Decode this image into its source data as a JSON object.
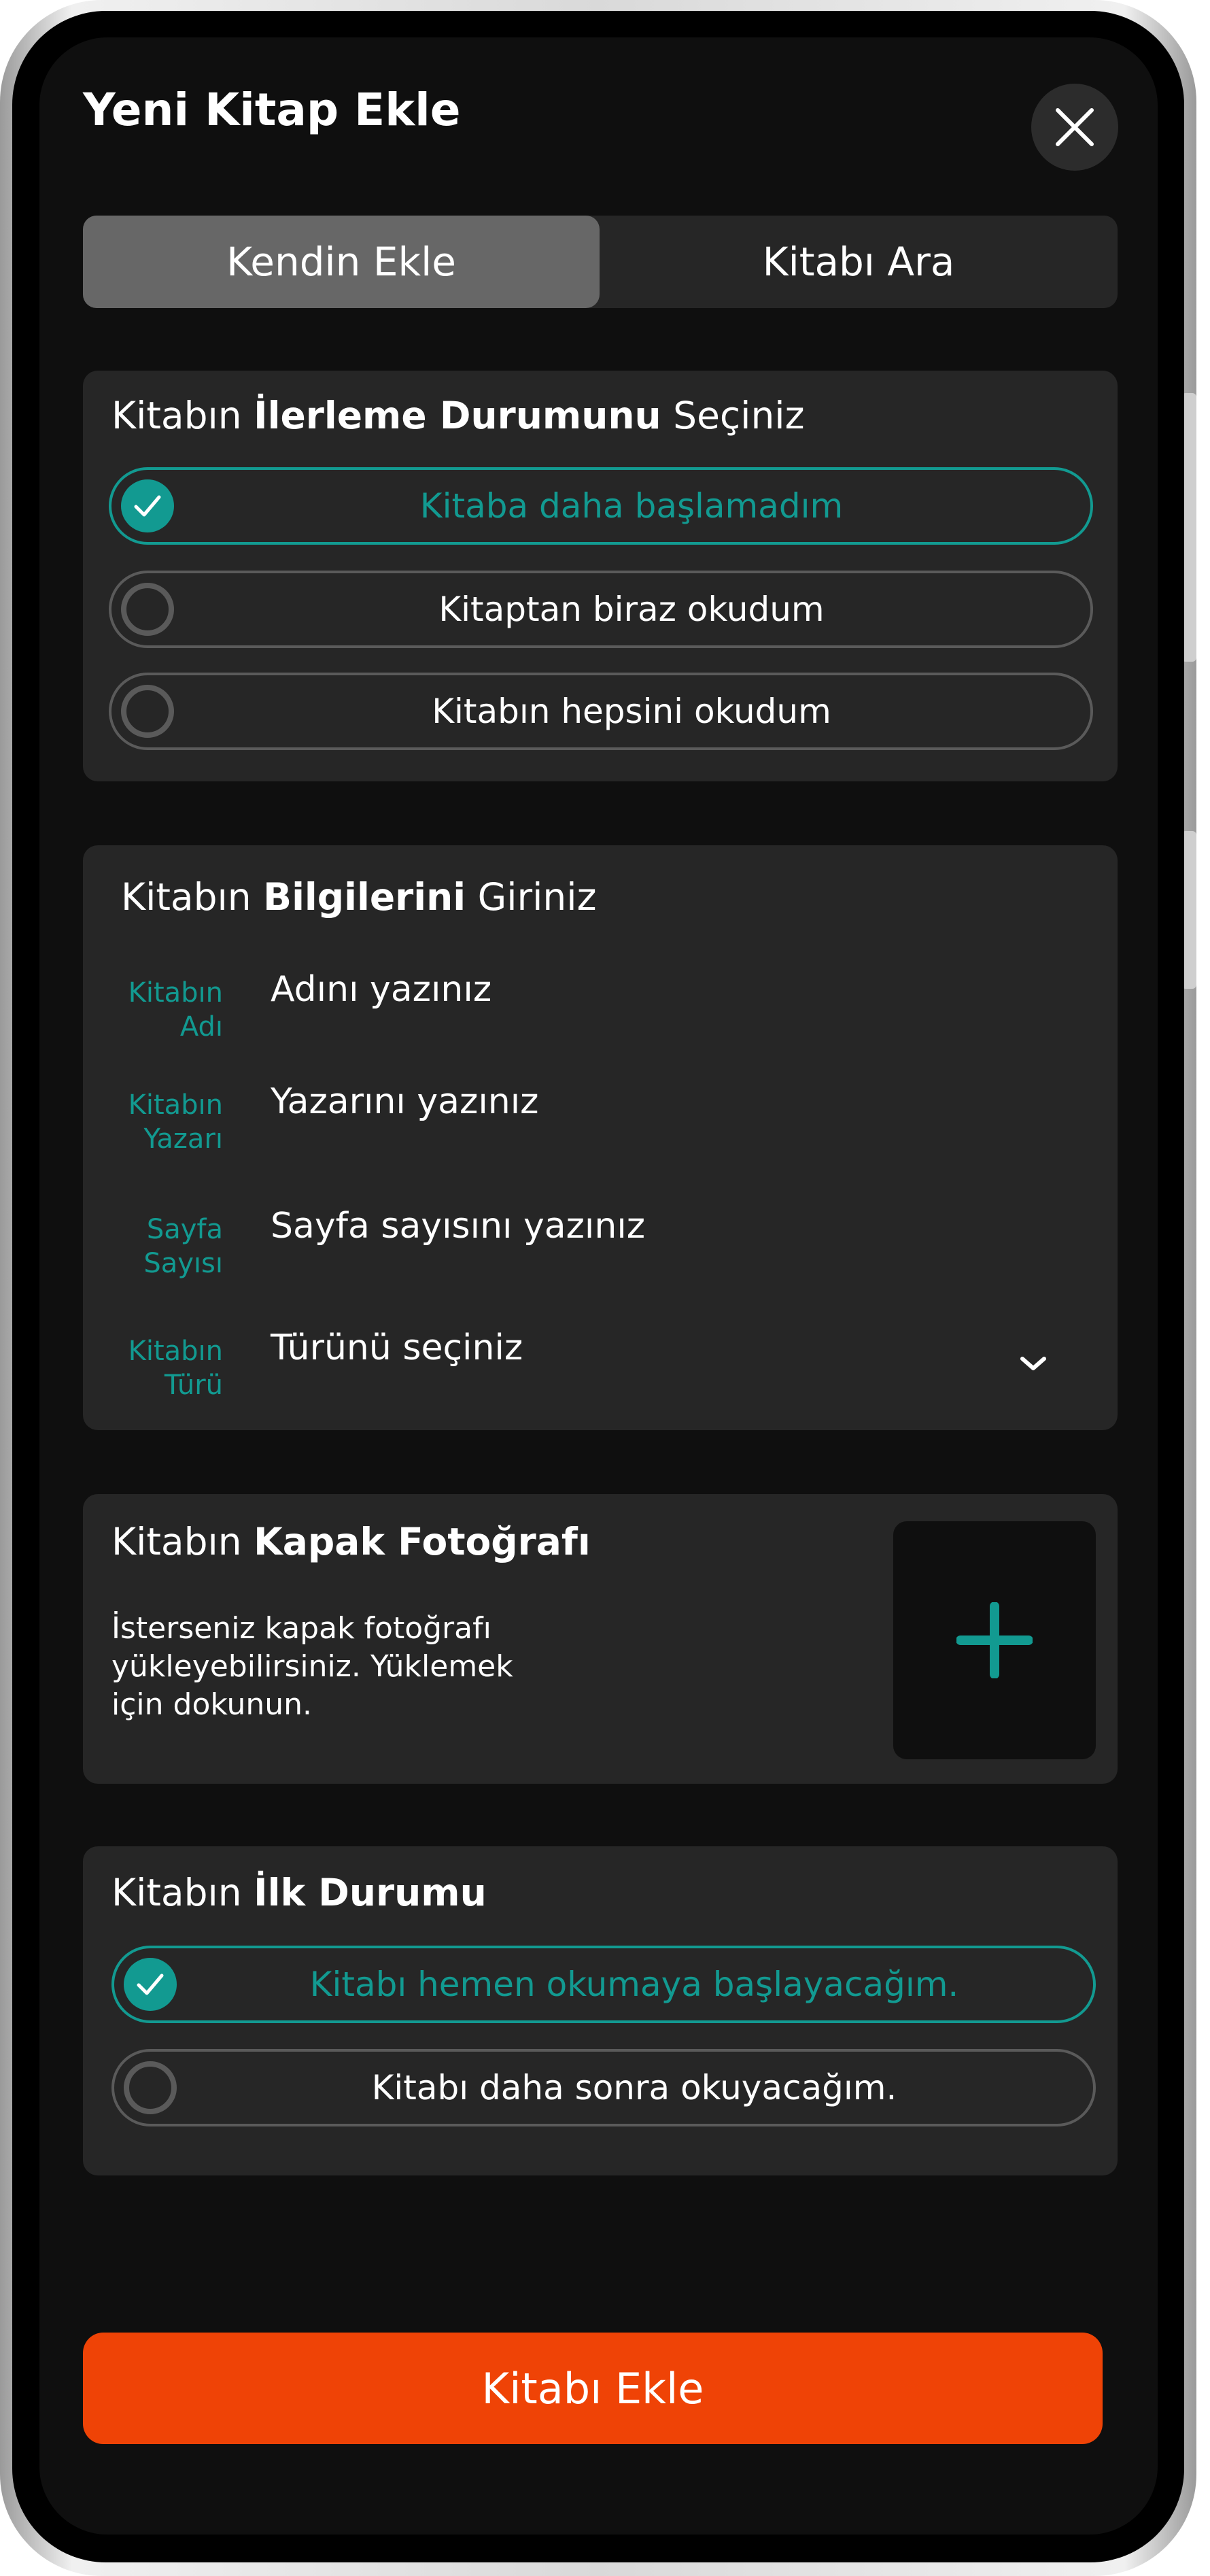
{
  "header": {
    "title": "Yeni Kitap Ekle",
    "close_icon": "close-icon"
  },
  "tabs": [
    {
      "label": "Kendin Ekle",
      "active": true
    },
    {
      "label": "Kitabı Ara",
      "active": false
    }
  ],
  "progress": {
    "title_pre": "Kitabın ",
    "title_bold": "İlerleme Durumunu",
    "title_post": " Seçiniz",
    "options": [
      {
        "label": "Kitaba daha başlamadım",
        "selected": true
      },
      {
        "label": "Kitaptan biraz okudum",
        "selected": false
      },
      {
        "label": "Kitabın hepsini okudum",
        "selected": false
      }
    ]
  },
  "info": {
    "title_pre": "Kitabın ",
    "title_bold": "Bilgilerini",
    "title_post": " Giriniz",
    "fields": [
      {
        "label_line1": "Kitabın",
        "label_line2": "Adı",
        "placeholder": "Adını yazınız"
      },
      {
        "label_line1": "Kitabın",
        "label_line2": "Yazarı",
        "placeholder": "Yazarını yazınız"
      },
      {
        "label_line1": "Sayfa",
        "label_line2": "Sayısı",
        "placeholder": "Sayfa sayısını yazınız"
      },
      {
        "label_line1": "Kitabın",
        "label_line2": "Türü",
        "placeholder": "Türünü seçiniz",
        "dropdown_icon": "chevron-down-icon"
      }
    ]
  },
  "cover": {
    "title_pre": "Kitabın ",
    "title_bold": "Kapak Fotoğrafı",
    "desc_line1": "İsterseniz kapak fotoğrafı",
    "desc_line2": "yükleyebilirsiniz. Yüklemek",
    "desc_line3": "için dokunun.",
    "add_icon": "plus-icon"
  },
  "initial_state": {
    "title_pre": "Kitabın ",
    "title_bold": "İlk Durumu",
    "options": [
      {
        "label": "Kitabı hemen okumaya başlayacağım.",
        "selected": true
      },
      {
        "label": "Kitabı daha sonra okuyacağım.",
        "selected": false
      }
    ]
  },
  "cta": {
    "label": "Kitabı Ekle"
  },
  "colors": {
    "accent": "#129a91",
    "cta": "#ef4306",
    "card": "#262626",
    "background": "#0f0f0f"
  }
}
